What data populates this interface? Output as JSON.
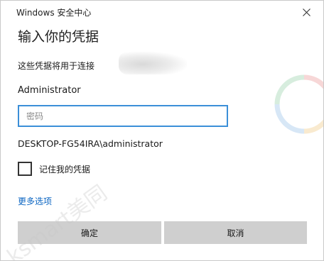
{
  "window": {
    "title": "Windows 安全中心"
  },
  "dialog": {
    "heading": "输入你的凭据",
    "connect_text": "这些凭据将用于连接",
    "username": "Administrator",
    "password_placeholder": "密码",
    "password_value": "",
    "account_line": "DESKTOP-FG54IRA\\administrator",
    "remember_label": "记住我的凭据",
    "remember_checked": false,
    "more_options": "更多选项",
    "ok_label": "确定",
    "cancel_label": "取消"
  },
  "watermark": {
    "text": "ksmart美同"
  },
  "icons": {
    "close": "close-icon",
    "watermark_logo": "watermark-logo-icon"
  },
  "colors": {
    "input_border": "#3b8fd8",
    "link": "#0b65c2",
    "button_bg": "#cfcfcf",
    "window_border": "#c9c9c9"
  }
}
